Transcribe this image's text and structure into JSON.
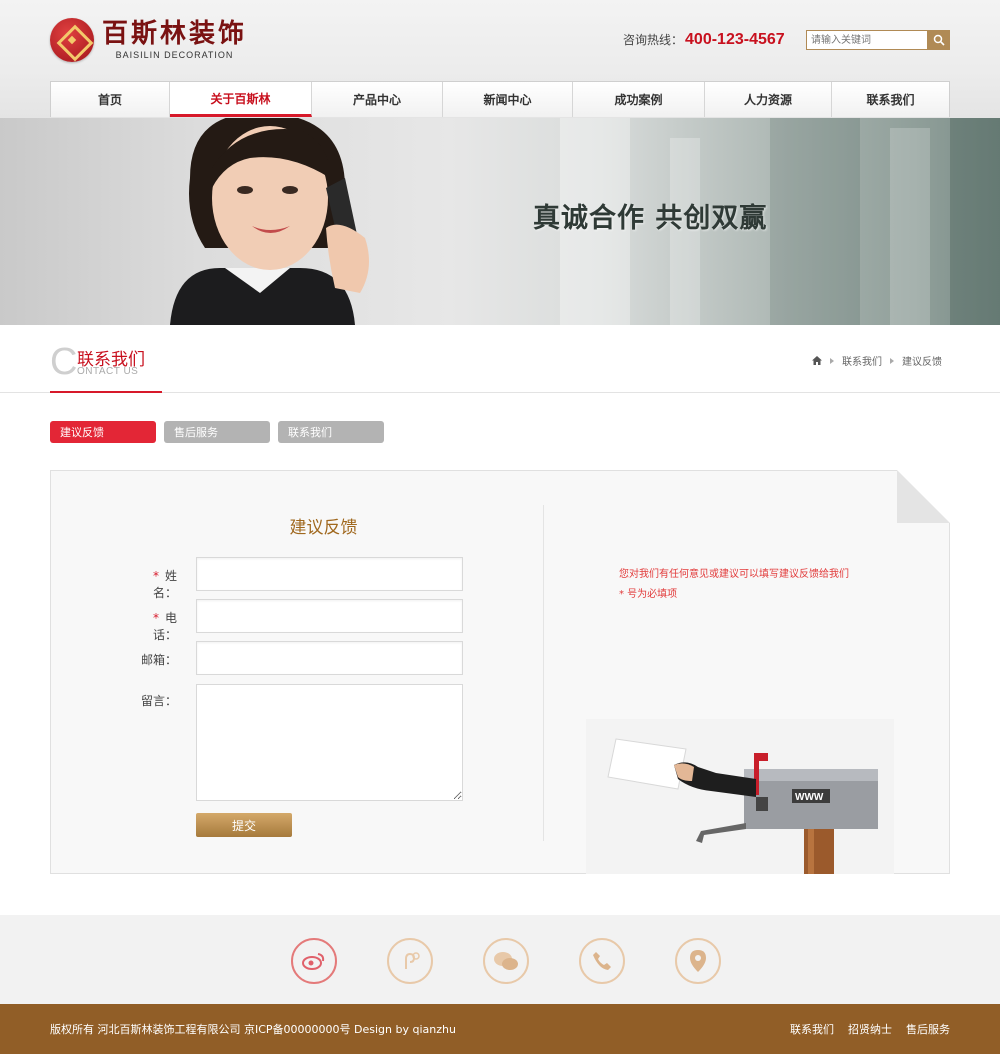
{
  "brand": {
    "name_cn": "百斯林装饰",
    "name_en": "BAISILIN  DECORATION"
  },
  "header": {
    "hotline_label": "咨询热线：",
    "hotline_number": "400-123-4567",
    "search_placeholder": "请输入关键词"
  },
  "nav": {
    "items": [
      {
        "label": "首页",
        "active": false
      },
      {
        "label": "关于百斯林",
        "active": true
      },
      {
        "label": "产品中心",
        "active": false
      },
      {
        "label": "新闻中心",
        "active": false
      },
      {
        "label": "成功案例",
        "active": false
      },
      {
        "label": "人力资源",
        "active": false
      },
      {
        "label": "联系我们",
        "active": false
      }
    ]
  },
  "banner": {
    "slogan": "真诚合作  共创双赢"
  },
  "section": {
    "title": "联系我们",
    "subtitle": "ONTACT US",
    "breadcrumb": [
      "联系我们",
      "建议反馈"
    ]
  },
  "subtabs": [
    {
      "label": "建议反馈",
      "active": true
    },
    {
      "label": "售后服务",
      "active": false
    },
    {
      "label": "联系我们",
      "active": false
    }
  ],
  "form": {
    "title": "建议反馈",
    "required_mark": "*",
    "name_label": "姓名：",
    "phone_label": "电话：",
    "email_label": "邮箱：",
    "message_label": "留言：",
    "name_value": "",
    "phone_value": "",
    "email_value": "",
    "message_value": "",
    "submit_label": "提交"
  },
  "notice": {
    "line1": "您对我们有任何意见或建议可以填写建议反馈给我们",
    "line2": "*  号为必填项"
  },
  "illustration": {
    "mailbox_label": "WWW"
  },
  "footer": {
    "icons": [
      "weibo-icon",
      "qq-icon",
      "wechat-icon",
      "phone-icon",
      "location-icon"
    ],
    "copyright": "版权所有  河北百斯林装饰工程有限公司   京ICP备00000000号  Design by qianzhu",
    "links": [
      "联系我们",
      "招贤纳士",
      "售后服务"
    ]
  },
  "colors": {
    "accent_red": "#d7192a",
    "brand_gold": "#b08a55",
    "footer_brown": "#915e27"
  }
}
